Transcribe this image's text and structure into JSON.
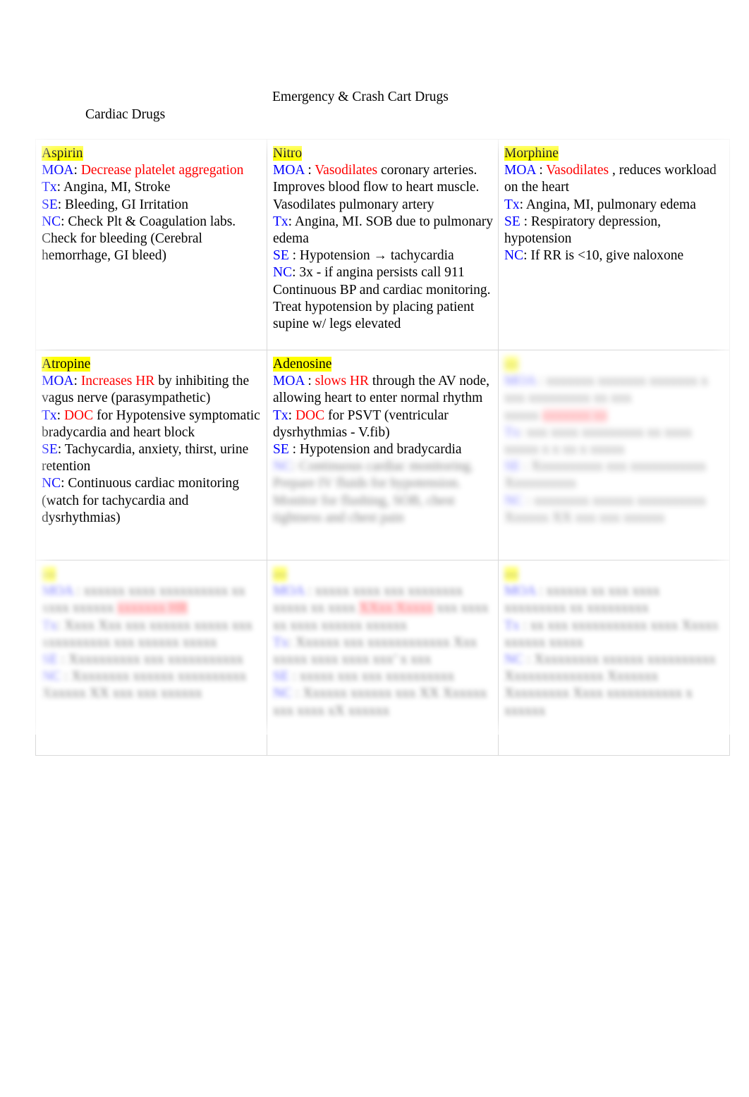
{
  "document": {
    "title": "Emergency & Crash Cart Drugs",
    "section_title": "Cardiac Drugs"
  },
  "colors": {
    "label_blue": "#0000FF",
    "emphasis_red": "#FF0000",
    "highlight_yellow": "#FFFF00",
    "highlight_red": "#FFC7CE",
    "body_black": "#000000",
    "table_border": "#D9D9D9"
  },
  "table": {
    "columns": 3,
    "rows": 3,
    "cells": [
      {
        "id": "aspirin",
        "name": "Aspirin",
        "legible": true,
        "lines": [
          {
            "segments": [
              {
                "text": "MOA",
                "style": "label"
              },
              {
                "text": ": ",
                "style": "plain"
              },
              {
                "text": "Decrease platelet aggregation",
                "style": "red"
              }
            ]
          },
          {
            "segments": [
              {
                "text": "Tx",
                "style": "label"
              },
              {
                "text": ":  Angina, MI, Stroke",
                "style": "plain"
              }
            ]
          },
          {
            "segments": [
              {
                "text": "SE",
                "style": "label"
              },
              {
                "text": ": Bleeding, GI Irritation",
                "style": "plain"
              }
            ]
          },
          {
            "segments": [
              {
                "text": "NC",
                "style": "label"
              },
              {
                "text": ": Check Plt & Coagulation labs. Check for bleeding (Cerebral hemorrhage, GI bleed)",
                "style": "plain"
              }
            ]
          }
        ]
      },
      {
        "id": "nitro",
        "name": "Nitro",
        "legible": true,
        "lines": [
          {
            "segments": [
              {
                "text": "MOA",
                "style": "label"
              },
              {
                "text": " : ",
                "style": "plain"
              },
              {
                "text": "Vasodilates",
                "style": "red"
              },
              {
                "text": "  coronary arteries. Improves blood flow to heart muscle. Vasodilates pulmonary artery",
                "style": "plain"
              }
            ]
          },
          {
            "segments": [
              {
                "text": "Tx",
                "style": "label"
              },
              {
                "text": ": Angina, MI. SOB due to pulmonary edema",
                "style": "plain"
              }
            ]
          },
          {
            "segments": [
              {
                "text": "SE",
                "style": "label"
              },
              {
                "text": " : Hypotension → tachycardia",
                "style": "plain"
              }
            ]
          },
          {
            "segments": [
              {
                "text": "NC",
                "style": "label"
              },
              {
                "text": ":  3x - if angina persists call 911 Continuous BP and cardiac monitoring. Treat hypotension by placing patient supine w/ legs elevated",
                "style": "plain"
              }
            ]
          }
        ]
      },
      {
        "id": "morphine",
        "name": "Morphine",
        "legible": true,
        "lines": [
          {
            "segments": [
              {
                "text": "MOA",
                "style": "label"
              },
              {
                "text": " : ",
                "style": "plain"
              },
              {
                "text": "Vasodilates",
                "style": "red"
              },
              {
                "text": " , reduces workload on the heart",
                "style": "plain"
              }
            ]
          },
          {
            "segments": [
              {
                "text": "Tx",
                "style": "label"
              },
              {
                "text": ": Angina, MI, pulmonary edema",
                "style": "plain"
              }
            ]
          },
          {
            "segments": [
              {
                "text": "SE",
                "style": "label"
              },
              {
                "text": " : Respiratory depression, hypotension",
                "style": "plain"
              }
            ]
          },
          {
            "segments": [
              {
                "text": "NC",
                "style": "label"
              },
              {
                "text": ":  If RR is <10, give naloxone",
                "style": "plain"
              }
            ]
          }
        ]
      },
      {
        "id": "atropine",
        "name": "Atropine",
        "legible": true,
        "lines": [
          {
            "segments": [
              {
                "text": "MOA",
                "style": "label"
              },
              {
                "text": ":  ",
                "style": "plain"
              },
              {
                "text": "Increases HR",
                "style": "red"
              },
              {
                "text": " by inhibiting the vagus nerve (parasympathetic)",
                "style": "plain"
              }
            ]
          },
          {
            "segments": [
              {
                "text": "Tx",
                "style": "label"
              },
              {
                "text": ":  ",
                "style": "plain"
              },
              {
                "text": "DOC",
                "style": "red"
              },
              {
                "text": "  for Hypotensive symptomatic bradycardia and heart block",
                "style": "plain"
              }
            ]
          },
          {
            "segments": [
              {
                "text": "SE",
                "style": "label"
              },
              {
                "text": ": Tachycardia, anxiety, thirst, urine retention",
                "style": "plain"
              }
            ]
          },
          {
            "segments": [
              {
                "text": "NC",
                "style": "label"
              },
              {
                "text": ": Continuous cardiac monitoring (watch for tachycardia and dysrhythmias)",
                "style": "plain"
              }
            ]
          }
        ]
      },
      {
        "id": "adenosine",
        "name": "Adenosine",
        "legible": true,
        "partial_blur": true,
        "lines": [
          {
            "segments": [
              {
                "text": "MOA",
                "style": "label"
              },
              {
                "text": " : ",
                "style": "plain"
              },
              {
                "text": "slows HR",
                "style": "red"
              },
              {
                "text": "  through the AV node, allowing heart to enter normal rhythm",
                "style": "plain"
              }
            ]
          },
          {
            "segments": [
              {
                "text": "Tx",
                "style": "label"
              },
              {
                "text": ":  ",
                "style": "plain"
              },
              {
                "text": "DOC",
                "style": "red"
              },
              {
                "text": "  for PSVT (ventricular dysrhythmias - V.fib)",
                "style": "plain"
              }
            ]
          },
          {
            "segments": [
              {
                "text": "SE",
                "style": "label"
              },
              {
                "text": " : Hypotension and bradycardia",
                "style": "plain"
              }
            ]
          }
        ],
        "blurred_tail": [
          {
            "segments": [
              {
                "text": "NC",
                "style": "label"
              },
              {
                "text": ": Continuous cardiac monitoring. Prepare IV fluids for hypotension. Monitor for flushing, SOB, chest tightness and chest pain",
                "style": "plain"
              }
            ]
          }
        ]
      },
      {
        "id": "row2-col3",
        "name": "—",
        "legible": false,
        "blur_level": "strong",
        "note": "Cell content is blurred and illegible in the scan",
        "lines": [
          {
            "segments": [
              {
                "text": "MOA",
                "style": "label"
              },
              {
                "text": " : ",
                "style": "plain"
              },
              {
                "text": "xxxxxxx xxxxxxx",
                "style": "plain"
              },
              {
                "text": " xxxxxxx x xxx xxxxxxxxx xx xxx",
                "style": "plain"
              }
            ]
          },
          {
            "segments": [
              {
                "text": "xxxxx",
                "style": "plain"
              },
              {
                "text": "  ",
                "style": "plain"
              },
              {
                "text": "xxxxxxx xx",
                "style": "hl-red"
              }
            ]
          },
          {
            "segments": [
              {
                "text": "Tx",
                "style": "label"
              },
              {
                "text": ": xxx xxxx xxxxxxxxx xx xxxx xxxxx x x xx x xxxxx",
                "style": "plain"
              }
            ]
          },
          {
            "segments": [
              {
                "text": "SE",
                "style": "label"
              },
              {
                "text": " : Xxxxxxxxxx xxx xxxxxxxxxxx Xxxxxxxxxx",
                "style": "plain"
              }
            ]
          },
          {
            "segments": [
              {
                "text": "NC",
                "style": "label"
              },
              {
                "text": " : xxxxxxxx xxxxxx xxxxxxxxxx Xxxxxx XX xxx xxx xxxxxx",
                "style": "plain"
              }
            ]
          }
        ]
      },
      {
        "id": "row3-col1",
        "name": "—",
        "legible": false,
        "blur_level": "normal",
        "note": "Cell content is blurred and illegible in the scan",
        "lines": [
          {
            "segments": [
              {
                "text": "MOA",
                "style": "label"
              },
              {
                "text": " : ",
                "style": "plain"
              },
              {
                "text": "xxxxxx xxxx xxxxxxxxxx xx xxxx xxxxxx ",
                "style": "plain"
              },
              {
                "text": "xxxxxxx HR",
                "style": "hl-red"
              }
            ]
          },
          {
            "segments": [
              {
                "text": "Tx",
                "style": "label"
              },
              {
                "text": ":  Xxxx Xxx xxx xxxxxx xxxxx xxx xxxxxxxxxx xxx xxxxxx xxxxx",
                "style": "plain"
              }
            ]
          },
          {
            "segments": [
              {
                "text": "SE",
                "style": "label"
              },
              {
                "text": " : Xxxxxxxxxx xxx xxxxxxxxxxx",
                "style": "plain"
              }
            ]
          },
          {
            "segments": [
              {
                "text": "NC",
                "style": "label"
              },
              {
                "text": " : Xxxxxxxx xxxxxx xxxxxxxxxx Xxxxxx XX xxx xxx xxxxxx",
                "style": "plain"
              }
            ]
          }
        ]
      },
      {
        "id": "row3-col2",
        "name": "—",
        "legible": false,
        "blur_level": "normal",
        "note": "Cell content is blurred and illegible in the scan",
        "lines": [
          {
            "segments": [
              {
                "text": "MOA",
                "style": "label"
              },
              {
                "text": " : ",
                "style": "plain"
              },
              {
                "text": "xxxxx xxxx xxx  xxxxxxxx xxxxx xx xxxx ",
                "style": "plain"
              },
              {
                "text": "XXxx Xxxxx",
                "style": "hl-red"
              },
              {
                "text": " xxx xxxx xx xxxx xxxxxx xxxxxx",
                "style": "plain"
              }
            ]
          },
          {
            "segments": [
              {
                "text": "Tx",
                "style": "label"
              },
              {
                "text": ":  Xxxxxx xxx xxxxxxxxxxxx Xxx xxxxx xxxx xxxx xxx’ x xxx",
                "style": "plain"
              }
            ]
          },
          {
            "segments": [
              {
                "text": "SE",
                "style": "label"
              },
              {
                "text": " : xxxxx xxx xxx xxxxxxxxxx",
                "style": "plain"
              }
            ]
          },
          {
            "segments": [
              {
                "text": "NC",
                "style": "label"
              },
              {
                "text": " : Xxxxxx xxxxxx xxx XX Xxxxxx xxx xxxx xX xxxxxx",
                "style": "plain"
              }
            ]
          }
        ]
      },
      {
        "id": "row3-col3",
        "name": "—",
        "legible": false,
        "blur_level": "normal",
        "note": "Cell content is blurred and illegible in the scan",
        "lines": [
          {
            "segments": [
              {
                "text": "MOA",
                "style": "label"
              },
              {
                "text": " : ",
                "style": "plain"
              },
              {
                "text": "xxxxxx xx xxx xxxx xxxxxxxxx xx xxxxxxxxx",
                "style": "plain"
              }
            ]
          },
          {
            "segments": [
              {
                "text": "Tx",
                "style": "label"
              },
              {
                "text": " :  xx xxx xxxxxxxxxxx xxxx Xxxxx xxxxxx xxxxx",
                "style": "plain"
              }
            ]
          },
          {
            "segments": [
              {
                "text": "NC",
                "style": "label"
              },
              {
                "text": " : Xxxxxxxxx xxxxxx xxxxxxxxxx Xxxxxxxxxxxxxx Xxxxxxx Xxxxxxxxx Xxxx xxxxxxxxxxx x xxxxxx",
                "style": "plain"
              }
            ]
          }
        ]
      }
    ]
  }
}
